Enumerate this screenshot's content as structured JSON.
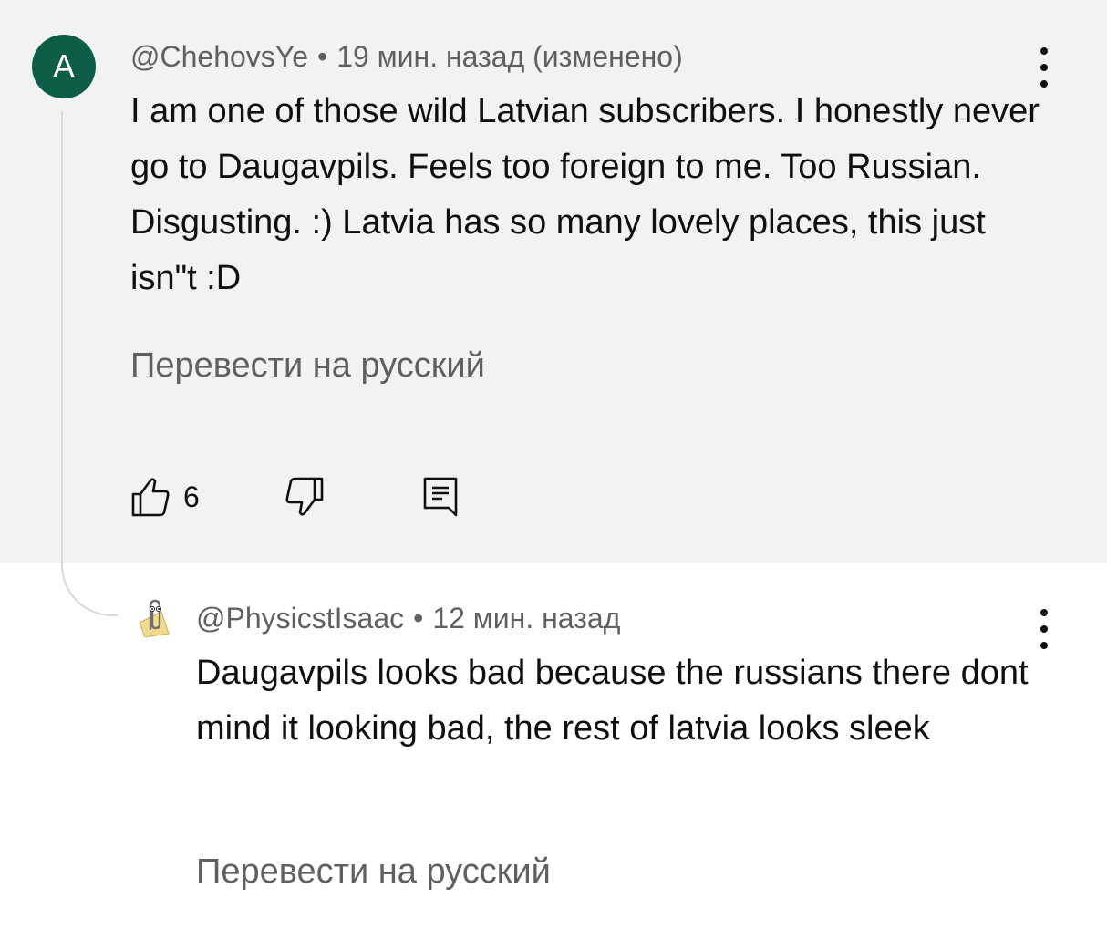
{
  "comment": {
    "avatar_letter": "A",
    "avatar_color": "#0b5d47",
    "author": "@ChehovsYe",
    "separator": "•",
    "time": "19 мин. назад (изменено)",
    "text": "I am one of those wild Latvian subscribers. I honestly never go to Daugavpils. Feels too foreign to me. Too Russian. Disgusting. :) Latvia has so many lovely places, this just isn\"t :D",
    "translate_label": "Перевести на русский",
    "like_count": "6",
    "icons": {
      "more": "more-vertical-icon",
      "like": "thumb-up-icon",
      "dislike": "thumb-down-icon",
      "reply": "comment-reply-icon"
    }
  },
  "reply": {
    "avatar_icon": "paperclip-assistant-icon",
    "author": "@PhysicstIsaac",
    "separator": "•",
    "time": "12 мин. назад",
    "text": "Daugavpils looks bad because the russians there dont mind it looking bad, the rest of latvia looks sleek",
    "translate_label": "Перевести на русский"
  },
  "colors": {
    "highlight_bg": "#f2f2f2",
    "secondary_text": "#606060",
    "primary_text": "#0f0f0f"
  }
}
